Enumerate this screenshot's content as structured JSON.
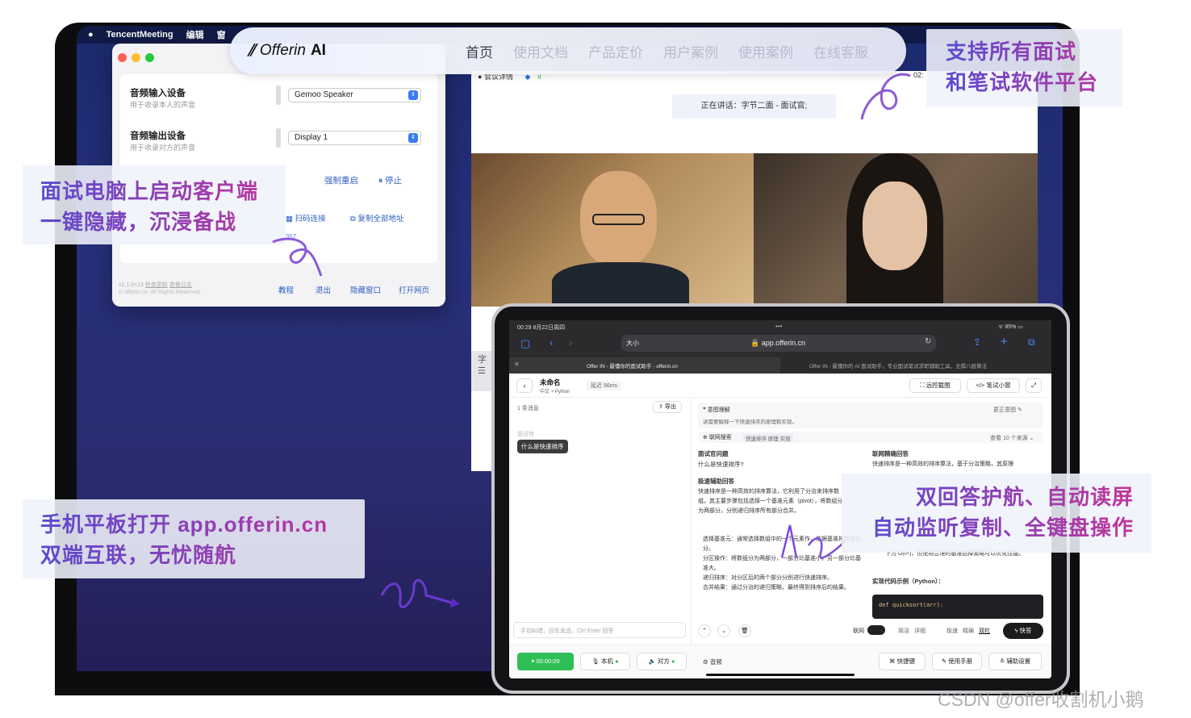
{
  "menubar": {
    "apple": "",
    "app_name": "TencentMeeting",
    "menu_edit": "编辑",
    "menu_window": "窗"
  },
  "nav": {
    "brand_name": "Offerin",
    "brand_suffix": "AI",
    "items": [
      "首页",
      "使用文档",
      "产品定价",
      "用户案例",
      "使用案例",
      "在线客服"
    ]
  },
  "settings_window": {
    "input_device_label": "音频输入设备",
    "input_device_sub": "用于收录本人的声音",
    "input_device_value": "Gemoo Speaker",
    "output_device_label": "音频输出设备",
    "output_device_sub": "用于收录对方的声音",
    "output_device_value": "Display 1",
    "force_restart": "强制重启",
    "stop": "停止",
    "scan_connect": "扫码连接",
    "copy_all": "复制全部地址",
    "code_fragment": "357",
    "version": "v1.1.0+13",
    "check_update": "检查更新",
    "view_log": "查看日志",
    "copyright": "© offerin.cn. All Rights Reserved.",
    "footer_buttons": [
      "教程",
      "退出",
      "隐藏窗口",
      "打开网页"
    ]
  },
  "meeting": {
    "header_meeting_detail": "会议详情",
    "speaking": "正在讲话：字节二面 - 面试官;",
    "time_fragment": "02:",
    "side_char": "字"
  },
  "overlays": {
    "top_right_line1": "支持所有面试",
    "top_right_line2": "和笔试软件平台",
    "left_top_line1": "面试电脑上启动客户端",
    "left_top_line2": "一键隐藏，沉浸备战",
    "left_bottom_line1": "手机平板打开 app.offerin.cn",
    "left_bottom_line2": "双端互联，无忧随航",
    "right_bottom_line1": "双回答护航、自动读屏",
    "right_bottom_line2": "自动监听复制、全键盘操作"
  },
  "ipad": {
    "status_time": "00:29",
    "status_date": "8月22日周四",
    "battery": "85%",
    "text_size": "大小",
    "url": "app.offerin.cn",
    "tab1": "Offer IN - 最懂你的面试助手 - offerin.cn",
    "tab2": "Offer IN - 最懂你的 AI 面试助手，专业面试笔试求职辅助工具，无惧八股算法",
    "title": "未命名",
    "subtitle": "中文 + Python",
    "latency": "延迟 56ms",
    "screenshot_btn": "远控截图",
    "written_btn": "笔试小窗",
    "msg_count": "1 条消息",
    "export": "导出",
    "role": "面试官",
    "bubble": "什么是快速排序",
    "intent_title": "意图理解",
    "intent_edit": "更正意图",
    "intent_text": "讲需要解释一下快速排序的原理和实现。",
    "web_search": "联网搜索",
    "search_query": "快速排序 原理 实现",
    "view_sources": "查看 10 个来源",
    "q_title": "面试官问题",
    "q_text": "什么是快速排序?",
    "net_answer_title": "联网精确回答",
    "net_answer_text": "快速排序是一种高效的排序算法，基于分治策略，其原理",
    "quick_title": "极速辅助回答",
    "quick_text": "快速排序是一种高效的排序算法，它利用了分治来排序数组。其主要步骤包括选择一个基准元素（pivot），将数组分为两部分，分别递归排序所有部分合并。",
    "bullets": [
      "选择基准元：通常选择数组中的一个元素作，依据基准将数组划分。",
      "分区操作：将数组分为两部分，一部分比基准小，另一部分比基准大。",
      "递归排序：对分区后的两个部分分别进行快速排序。",
      "合并结果：通过分治的递归策略，最终得到排序后的结果。"
    ],
    "complexity": "下为 O(n²)，但使用合理的基准选择策略可以优化性能。",
    "code_title": "实现代码示例（Python）：",
    "code_line": "def quicksort(arr):",
    "input_placeholder": "手动纠错，回车发送，Ctrl Enter 回答",
    "network": "联网",
    "modes": [
      "简洁",
      "详细",
      "极速",
      "精确",
      "双栏"
    ],
    "quick_answer": "快答",
    "timer": "00:00:09",
    "local": "本机",
    "remote": "对方",
    "audio": "音频",
    "shortcuts": "快捷键",
    "manual": "使用手册",
    "settings": "辅助设置"
  },
  "watermark": "CSDN @offer收割机小鹅"
}
